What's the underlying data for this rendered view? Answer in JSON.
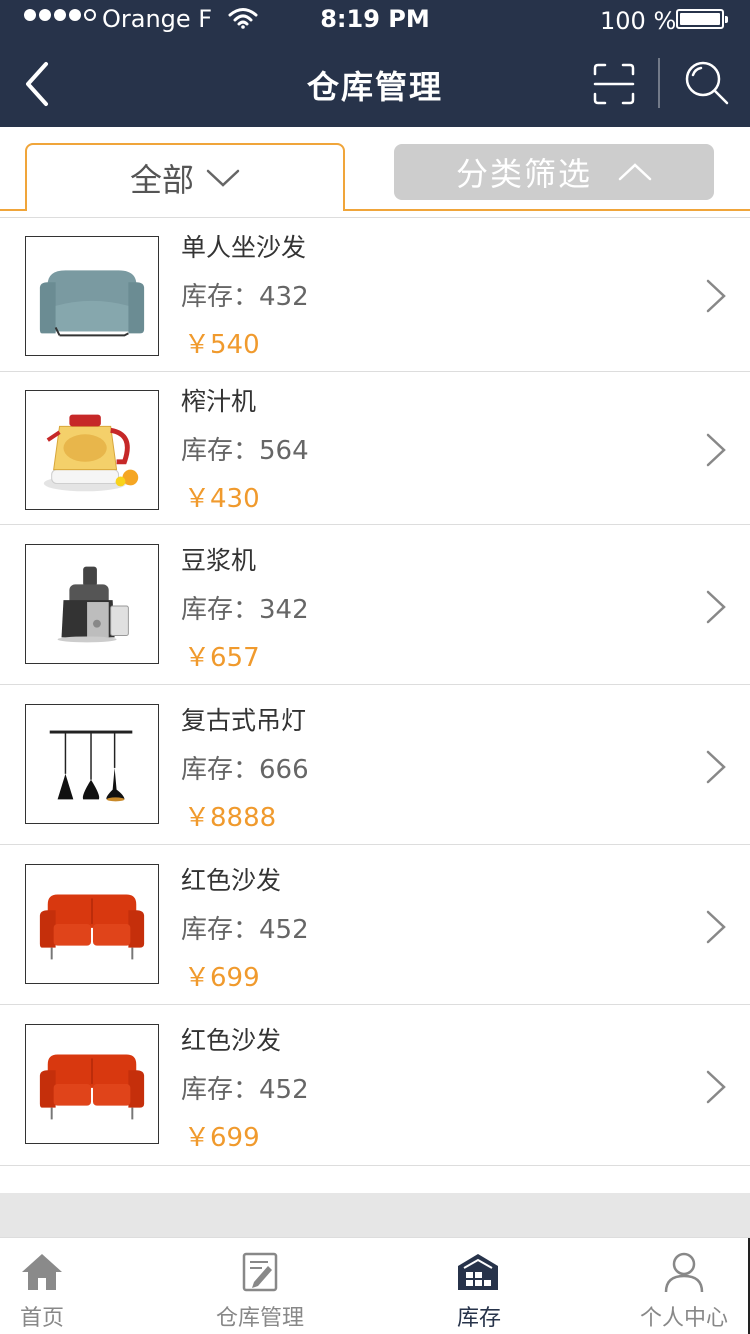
{
  "status_bar": {
    "carrier": "Orange F",
    "time": "8:19 PM",
    "battery": "100 %",
    "battery_level": 1.0
  },
  "nav": {
    "title": "仓库管理",
    "back_icon": "chevron-left-icon",
    "scan_icon": "scan-icon",
    "search_icon": "search-icon"
  },
  "filter": {
    "all_label": "全部",
    "category_label": "分类筛选"
  },
  "products": [
    {
      "name": "单人坐沙发",
      "stock": "库存：432",
      "price": "￥540",
      "image": "armchair"
    },
    {
      "name": "榨汁机",
      "stock": "库存：564",
      "price": "￥430",
      "image": "kettle"
    },
    {
      "name": "豆浆机",
      "stock": "库存：342",
      "price": "￥657",
      "image": "juicer"
    },
    {
      "name": "复古式吊灯",
      "stock": "库存：666",
      "price": "￥8888",
      "image": "pendant-lamp"
    },
    {
      "name": "红色沙发",
      "stock": "库存：452",
      "price": "￥699",
      "image": "red-sofa"
    },
    {
      "name": "红色沙发",
      "stock": "库存：452",
      "price": "￥699",
      "image": "red-sofa"
    }
  ],
  "tabbar": {
    "items": [
      {
        "label": "首页",
        "icon": "home-icon"
      },
      {
        "label": "仓库管理",
        "icon": "edit-document-icon"
      },
      {
        "label": "库存",
        "icon": "warehouse-icon"
      },
      {
        "label": "个人中心",
        "icon": "user-icon"
      }
    ],
    "active_index": 2
  },
  "colors": {
    "header_bg": "#27334a",
    "accent": "#f0a53a",
    "price": "#f09a2d",
    "inactive_tab_bg": "#cdcdcd"
  }
}
